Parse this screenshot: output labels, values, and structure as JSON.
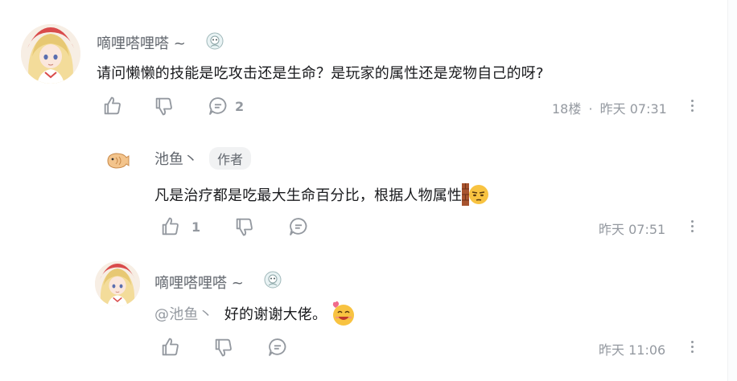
{
  "comment": {
    "username": "嘀哩嗒哩嗒 ~",
    "content": "请问懒懒的技能是吃攻击还是生命？是玩家的属性还是宠物自己的呀?",
    "like_count": "",
    "reply_count": "2",
    "floor": "18楼",
    "dot": "·",
    "time": "昨天 07:31"
  },
  "replies": [
    {
      "username": "池鱼丶",
      "tag": "作者",
      "content": "凡是治疗都是吃最大生命百分比，根据人物属性",
      "like_count": "1",
      "time": "昨天 07:51"
    },
    {
      "username": "嘀哩嗒哩嗒 ~",
      "mention": "@池鱼丶",
      "content": "好的谢谢大佬。",
      "like_count": "",
      "time": "昨天 11:06"
    }
  ],
  "icons": {
    "like": "thumbs-up-icon",
    "dislike": "thumbs-down-icon",
    "reply": "comment-icon",
    "more": "more-vertical-icon",
    "badge": "user-badge-icon",
    "emoji_wall": "wall-peek-emoji-icon",
    "emoji_happy": "happy-heart-emoji-icon"
  },
  "colors": {
    "text_primary": "#18191c",
    "text_secondary": "#61666d",
    "text_muted": "#9499a0"
  }
}
